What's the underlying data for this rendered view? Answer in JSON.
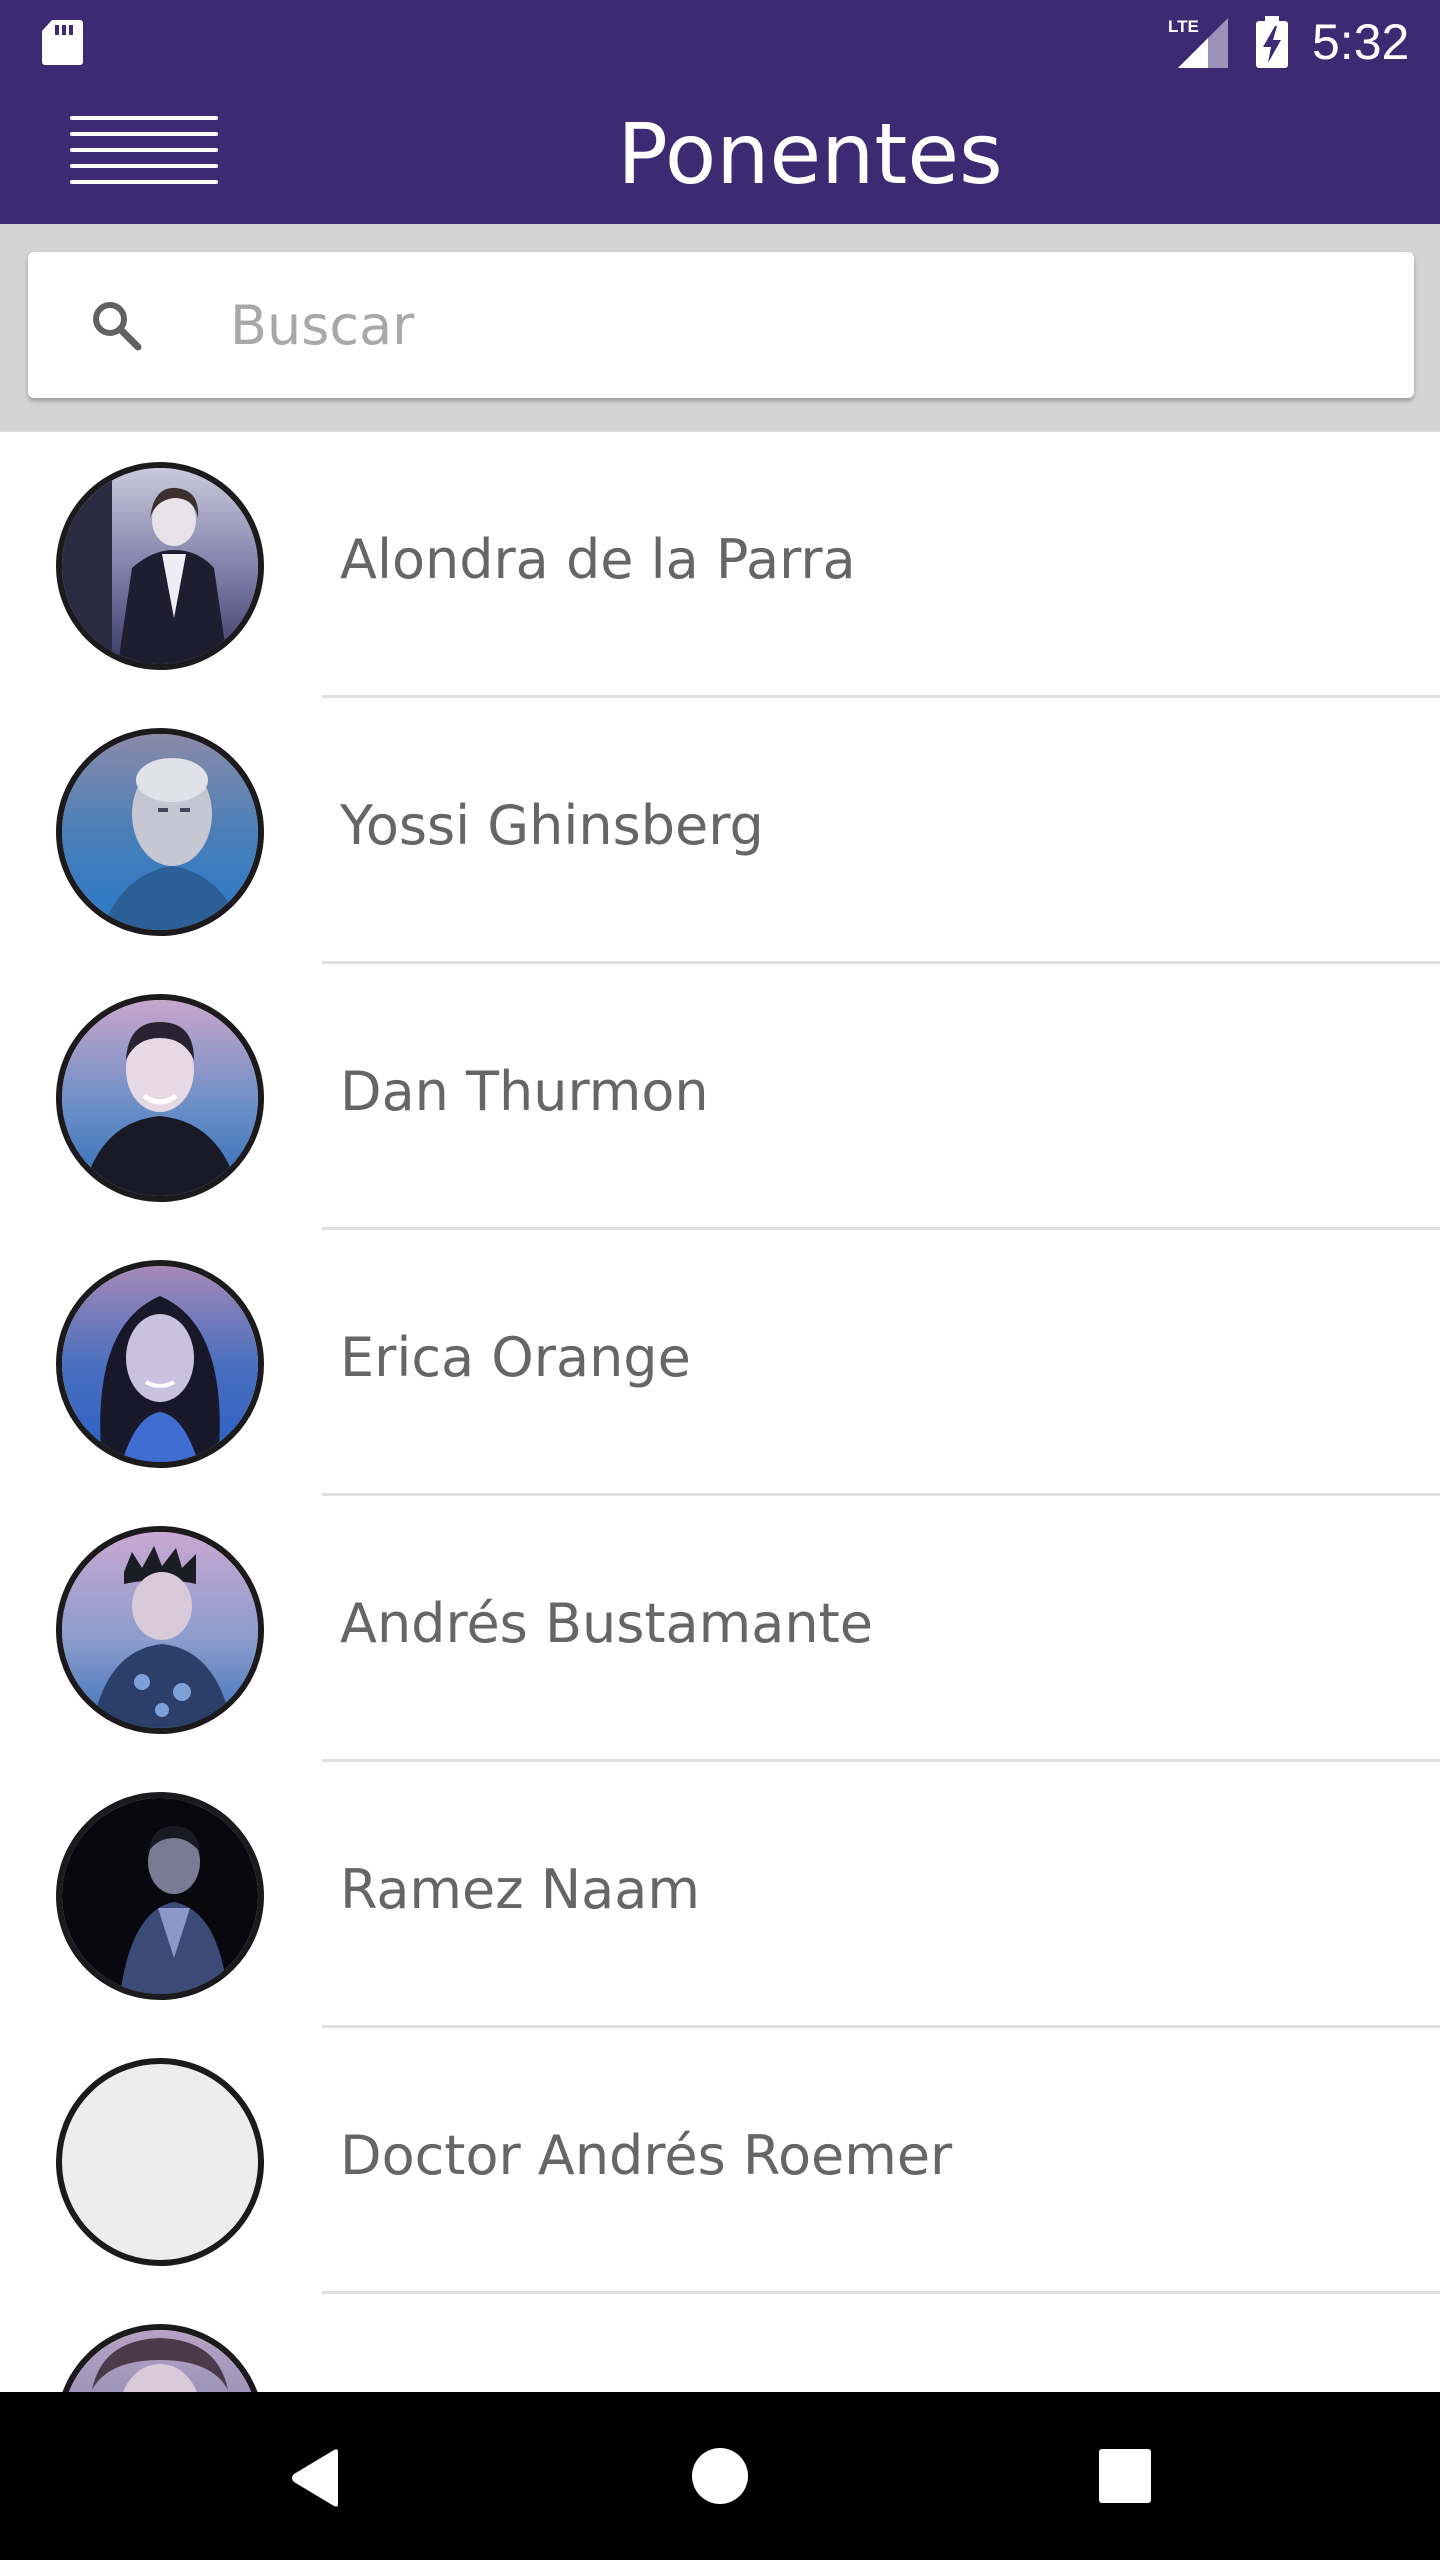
{
  "status_bar": {
    "time": "5:32",
    "network_label": "LTE",
    "icons": [
      "sd-card-icon",
      "lte-signal-icon",
      "battery-charging-icon"
    ]
  },
  "app_bar": {
    "title": "Ponentes",
    "menu_icon": "hamburger-menu-icon"
  },
  "search": {
    "placeholder": "Buscar",
    "value": "",
    "icon": "search-icon"
  },
  "speakers": [
    {
      "name": "Alondra de la Parra"
    },
    {
      "name": "Yossi Ghinsberg"
    },
    {
      "name": "Dan Thurmon"
    },
    {
      "name": "Erica Orange"
    },
    {
      "name": "Andrés Bustamante"
    },
    {
      "name": "Ramez Naam"
    },
    {
      "name": "Doctor Andrés Roemer"
    },
    {
      "name": ""
    }
  ],
  "nav_bar": {
    "icons": [
      "back-icon",
      "home-icon",
      "recents-icon"
    ]
  },
  "colors": {
    "primary": "#3c2a72",
    "search_bg": "#d4d4d4",
    "name_text": "#666666",
    "divider": "#e0e0e0",
    "avatar_border": "#1c1a1c"
  }
}
